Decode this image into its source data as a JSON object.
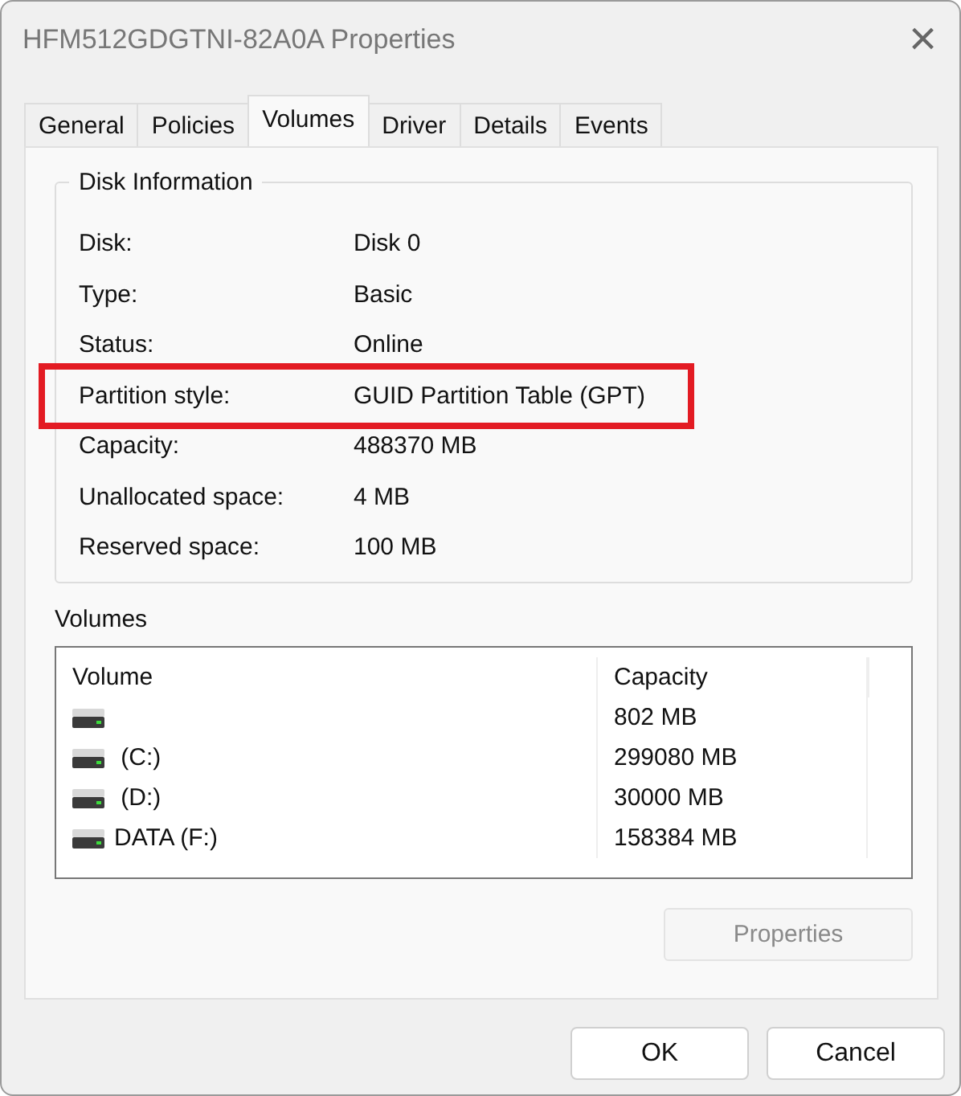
{
  "window": {
    "title": "HFM512GDGTNI-82A0A Properties",
    "close": "×"
  },
  "tabs": [
    {
      "label": "General",
      "selected": false
    },
    {
      "label": "Policies",
      "selected": false
    },
    {
      "label": "Volumes",
      "selected": true
    },
    {
      "label": "Driver",
      "selected": false
    },
    {
      "label": "Details",
      "selected": false
    },
    {
      "label": "Events",
      "selected": false
    }
  ],
  "disk_information": {
    "title": "Disk Information",
    "rows": [
      {
        "label": "Disk:",
        "value": "Disk 0",
        "highlighted": false
      },
      {
        "label": "Type:",
        "value": "Basic",
        "highlighted": false
      },
      {
        "label": "Status:",
        "value": "Online",
        "highlighted": false
      },
      {
        "label": "Partition style:",
        "value": "GUID Partition Table (GPT)",
        "highlighted": true
      },
      {
        "label": "Capacity:",
        "value": "488370 MB",
        "highlighted": false
      },
      {
        "label": "Unallocated space:",
        "value": "4 MB",
        "highlighted": false
      },
      {
        "label": "Reserved space:",
        "value": "100 MB",
        "highlighted": false
      }
    ]
  },
  "volumes": {
    "title": "Volumes",
    "columns": [
      "Volume",
      "Capacity"
    ],
    "rows": [
      {
        "volume": "",
        "capacity": "802 MB"
      },
      {
        "volume": " (C:)",
        "capacity": "299080 MB"
      },
      {
        "volume": " (D:)",
        "capacity": "30000 MB"
      },
      {
        "volume": "DATA (F:)",
        "capacity": "158384 MB"
      }
    ],
    "properties_button": {
      "label": "Properties",
      "disabled": true
    }
  },
  "buttons": [
    {
      "label": "OK"
    },
    {
      "label": "Cancel"
    }
  ]
}
